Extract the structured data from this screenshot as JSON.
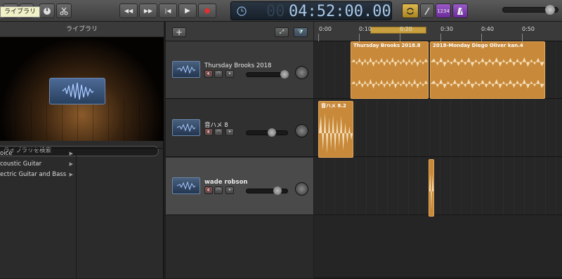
{
  "toolbar": {
    "tooltip": "ライブラリ",
    "lcd_dim": "00",
    "lcd_time": "04:52:00.00",
    "count_in_label": "1234",
    "rewind_label": "◀◀",
    "forward_label": "▶▶",
    "to_start_label": "|◀",
    "play_label": "▶",
    "record_label": "●"
  },
  "library": {
    "title": "ライブラリ",
    "search_placeholder": "ライブラリを検索",
    "items": [
      {
        "label": "oice"
      },
      {
        "label": "coustic Guitar"
      },
      {
        "label": "ectric Guitar and Bass"
      }
    ]
  },
  "tracks": [
    {
      "name": "Thursday Brooks 2018",
      "volume": 0.82
    },
    {
      "name": "音ハメ 8",
      "volume": 0.55
    },
    {
      "name": "wade robson",
      "volume": 0.68
    }
  ],
  "ruler": {
    "labels": [
      "0:00",
      "0:10",
      "0:20",
      "0:30",
      "0:40",
      "0:50"
    ]
  },
  "regions": [
    {
      "name": "Thursday Brooks 2018.8",
      "track": 0
    },
    {
      "name": "2018-Monday Diego Oliver kan.4",
      "track": 0
    },
    {
      "name": "音ハメ 8.2",
      "track": 1
    },
    {
      "name": "",
      "track": 2
    }
  ],
  "colors": {
    "region": "#c88a3a",
    "lcd_text": "#a8c8e8",
    "accent_purple": "#8a4ab8",
    "accent_yellow": "#c9a040"
  }
}
